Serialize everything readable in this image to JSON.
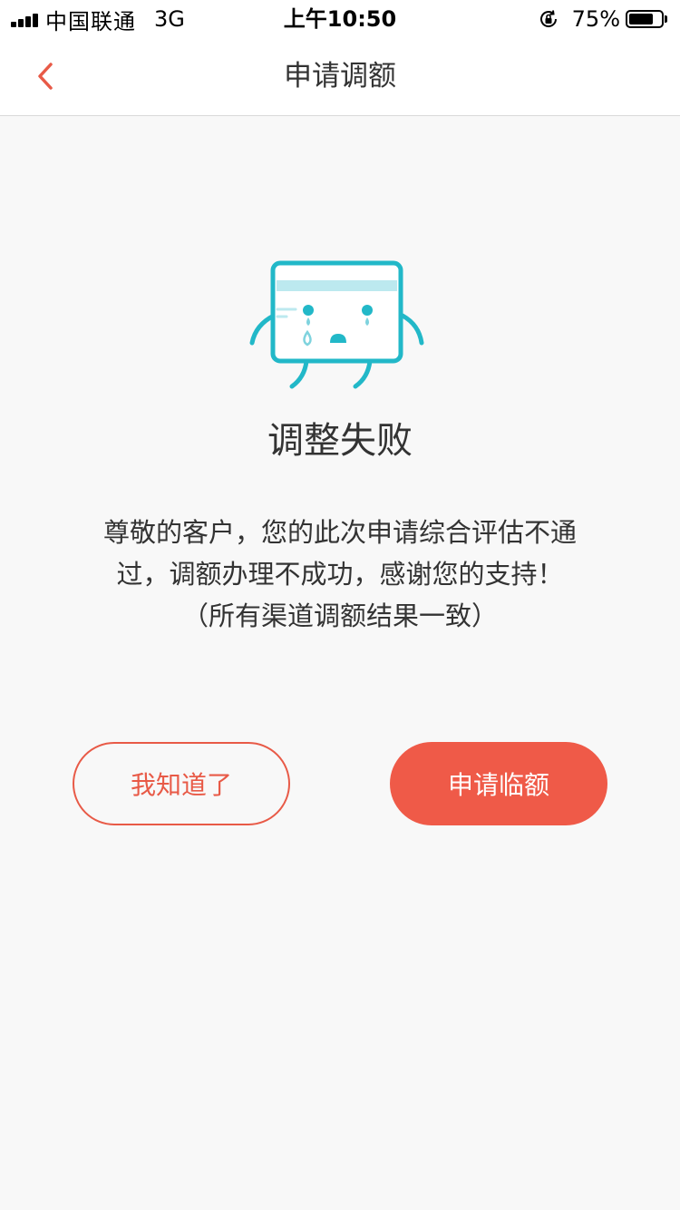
{
  "status_bar": {
    "carrier": "中国联通",
    "network": "3G",
    "time": "上午10:50",
    "battery": "75%",
    "battery_level": 0.75
  },
  "nav": {
    "title": "申请调额",
    "back_icon": "chevron-left-icon"
  },
  "result": {
    "illustration_icon": "crying-card-icon",
    "title": "调整失败",
    "message_lines": [
      "尊敬的客户，您的此次申请综合评估不通",
      "过，调额办理不成功，感谢您的支持！",
      "（所有渠道调额结果一致）"
    ]
  },
  "actions": {
    "acknowledge_label": "我知道了",
    "apply_temp_label": "申请临额"
  },
  "colors": {
    "accent": "#ef5a48",
    "mascot": "#22b8c8",
    "mascot_light": "#bce9ef",
    "background": "#f8f8f8"
  }
}
